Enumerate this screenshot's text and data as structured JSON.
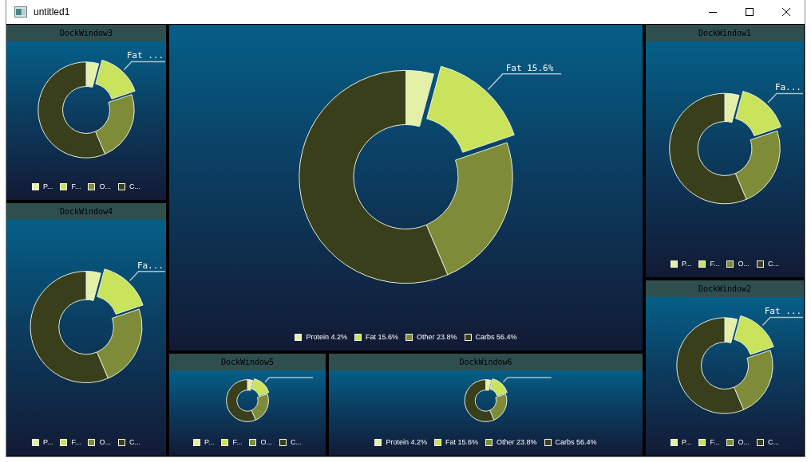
{
  "window": {
    "title": "untitled1"
  },
  "panels": [
    {
      "title": "DockWindow3",
      "callout": "Fat ...",
      "legend": [
        {
          "label": "P...",
          "color": "#e2f0a8"
        },
        {
          "label": "F...",
          "color": "#c9e35c"
        },
        {
          "label": "O...",
          "color": "#7e8c3a"
        },
        {
          "label": "C...",
          "color": "#3a3f1b"
        }
      ]
    },
    {
      "title": "DockWindow4",
      "callout": "Fa...",
      "legend": [
        {
          "label": "P...",
          "color": "#e2f0a8"
        },
        {
          "label": "F...",
          "color": "#c9e35c"
        },
        {
          "label": "O...",
          "color": "#7e8c3a"
        },
        {
          "label": "C...",
          "color": "#3a3f1b"
        }
      ]
    },
    {
      "callout": "Fat 15.6%",
      "legend": [
        {
          "label": "Protein 4.2%",
          "color": "#e2f0a8"
        },
        {
          "label": "Fat 15.6%",
          "color": "#c9e35c"
        },
        {
          "label": "Other 23.8%",
          "color": "#7e8c3a"
        },
        {
          "label": "Carbs 56.4%",
          "color": "#3a3f1b"
        }
      ]
    },
    {
      "title": "DockWindow5",
      "legend": [
        {
          "label": "P...",
          "color": "#e2f0a8"
        },
        {
          "label": "F...",
          "color": "#c9e35c"
        },
        {
          "label": "O...",
          "color": "#7e8c3a"
        },
        {
          "label": "C...",
          "color": "#3a3f1b"
        }
      ]
    },
    {
      "title": "DockWindow6",
      "legend": [
        {
          "label": "Protein 4.2%",
          "color": "#e2f0a8"
        },
        {
          "label": "Fat 15.6%",
          "color": "#c9e35c"
        },
        {
          "label": "Other 23.8%",
          "color": "#7e8c3a"
        },
        {
          "label": "Carbs 56.4%",
          "color": "#3a3f1b"
        }
      ]
    },
    {
      "title": "DockWindow1",
      "callout": "Fa...",
      "legend": [
        {
          "label": "P...",
          "color": "#e2f0a8"
        },
        {
          "label": "F...",
          "color": "#c9e35c"
        },
        {
          "label": "O...",
          "color": "#7e8c3a"
        },
        {
          "label": "C...",
          "color": "#3a3f1b"
        }
      ]
    },
    {
      "title": "DockWindow2",
      "callout": "Fat ...",
      "legend": [
        {
          "label": "P...",
          "color": "#e2f0a8"
        },
        {
          "label": "F...",
          "color": "#c9e35c"
        },
        {
          "label": "O...",
          "color": "#7e8c3a"
        },
        {
          "label": "C...",
          "color": "#3a3f1b"
        }
      ]
    }
  ]
}
